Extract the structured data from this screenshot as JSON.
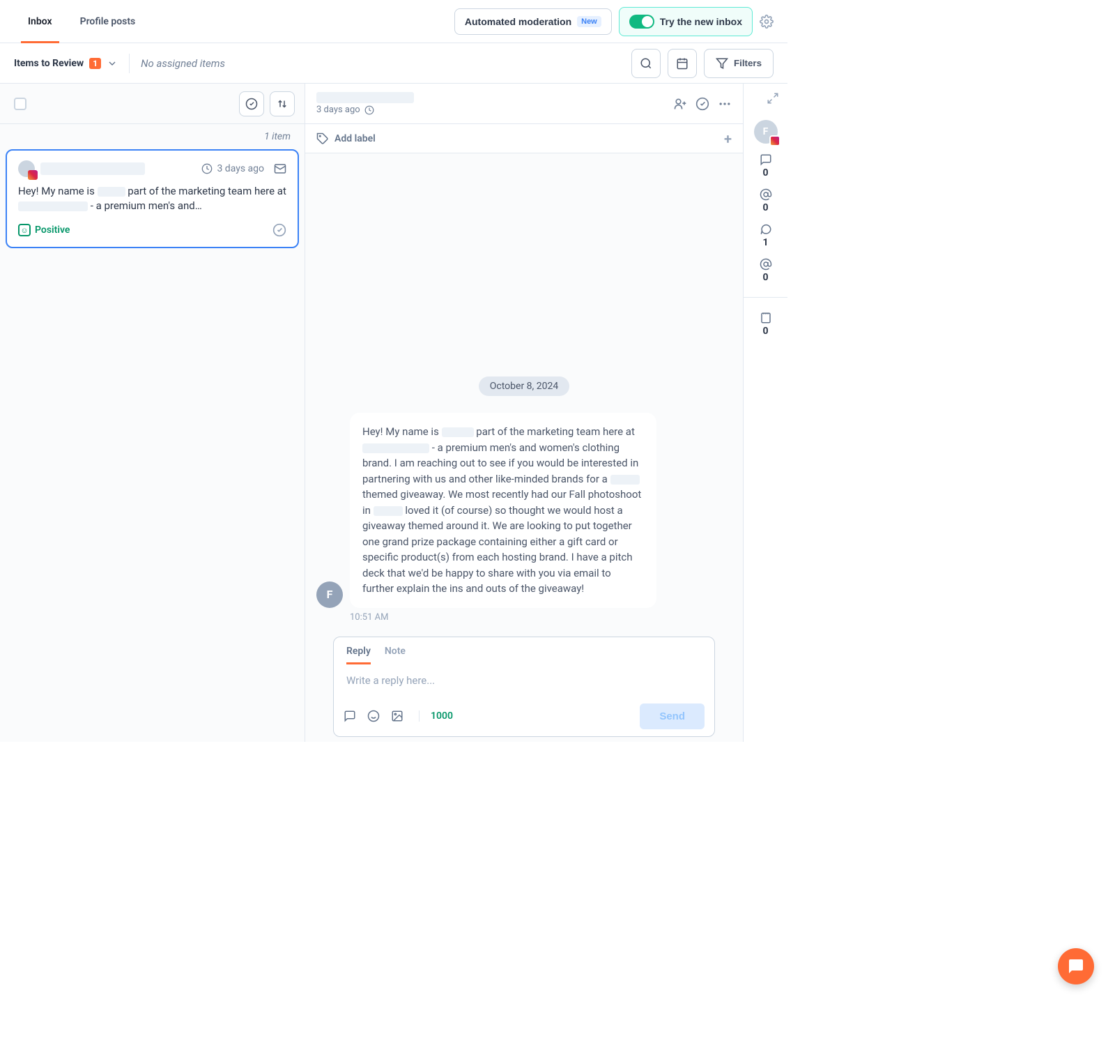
{
  "nav": {
    "tab_inbox": "Inbox",
    "tab_profile_posts": "Profile posts",
    "automated_moderation": "Automated moderation",
    "new_badge": "New",
    "try_new_inbox": "Try the new inbox"
  },
  "subheader": {
    "items_to_review": "Items to Review",
    "review_count": "1",
    "no_assigned": "No assigned items",
    "filters_label": "Filters"
  },
  "list": {
    "item_count": "1 item",
    "card": {
      "time": "3 days ago",
      "body_prefix": "Hey! My name is ",
      "body_mid": " part of the marketing team here at ",
      "body_suffix": " - a premium men's and…",
      "sentiment": "Positive"
    }
  },
  "detail": {
    "time": "3 days ago",
    "add_label": "Add label",
    "date_pill": "October 8, 2024",
    "avatar_letter": "F",
    "msg_p1": "Hey! My name is ",
    "msg_p2": " part of the marketing team here at ",
    "msg_p3": " - a premium men's and women's clothing brand. I am reaching out to see if you would be interested in partnering with us and other like-minded brands for a ",
    "msg_p4": " themed giveaway. We most recently had our Fall photoshoot in ",
    "msg_p5": " loved it (of course) so thought we would host a giveaway themed around it. We are looking to put together one grand prize package containing either a gift card or specific product(s) from each hosting brand. I have a pitch deck that we'd be happy to share with you via email to further explain the ins and outs of the giveaway!",
    "msg_time": "10:51 AM"
  },
  "composer": {
    "reply_tab": "Reply",
    "note_tab": "Note",
    "placeholder": "Write a reply here...",
    "char_count": "1000",
    "send": "Send"
  },
  "rail": {
    "avatar_letter": "F",
    "counts": [
      "0",
      "0",
      "1",
      "0",
      "0"
    ]
  }
}
